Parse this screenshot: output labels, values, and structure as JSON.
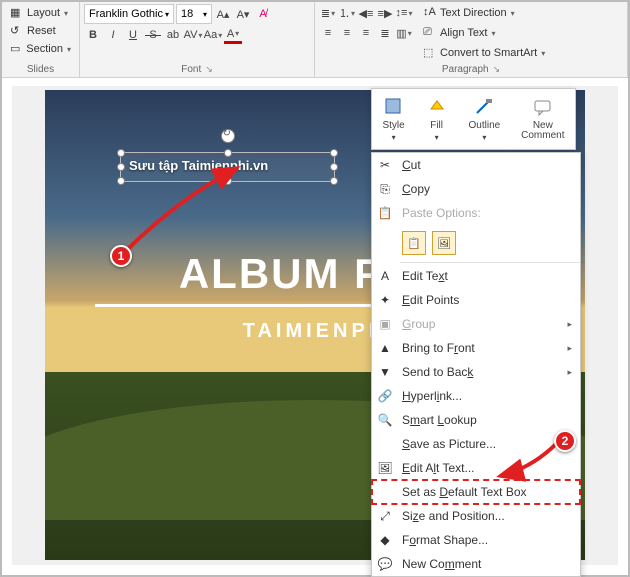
{
  "ribbon": {
    "slides": {
      "layout": "Layout",
      "reset": "Reset",
      "section": "Section",
      "label": "Slides"
    },
    "font": {
      "name": "Franklin Gothic",
      "size": "18",
      "label": "Font"
    },
    "paragraph": {
      "text_direction": "Text Direction",
      "align_text": "Align Text",
      "convert_smartart": "Convert to SmartArt",
      "label": "Paragraph"
    }
  },
  "minitoolbar": {
    "style": "Style",
    "fill": "Fill",
    "outline": "Outline",
    "new_comment": "New\nComment"
  },
  "context_menu": {
    "cut": "Cut",
    "copy": "Copy",
    "paste_options": "Paste Options:",
    "edit_text": "Edit Text",
    "edit_points": "Edit Points",
    "group": "Group",
    "bring_front": "Bring to Front",
    "send_back": "Send to Back",
    "hyperlink": "Hyperlink...",
    "smart_lookup": "Smart Lookup",
    "save_picture": "Save as Picture...",
    "edit_alt": "Edit Alt Text...",
    "set_default": "Set as Default Text Box",
    "size_position": "Size and Position...",
    "format_shape": "Format Shape...",
    "new_comment": "New Comment"
  },
  "slide": {
    "textbox_text": "Sưu tập Taimienphi.vn",
    "title": "ALBUM   PHO",
    "subtitle": "TAIMIENPH"
  },
  "badges": {
    "one": "1",
    "two": "2"
  }
}
